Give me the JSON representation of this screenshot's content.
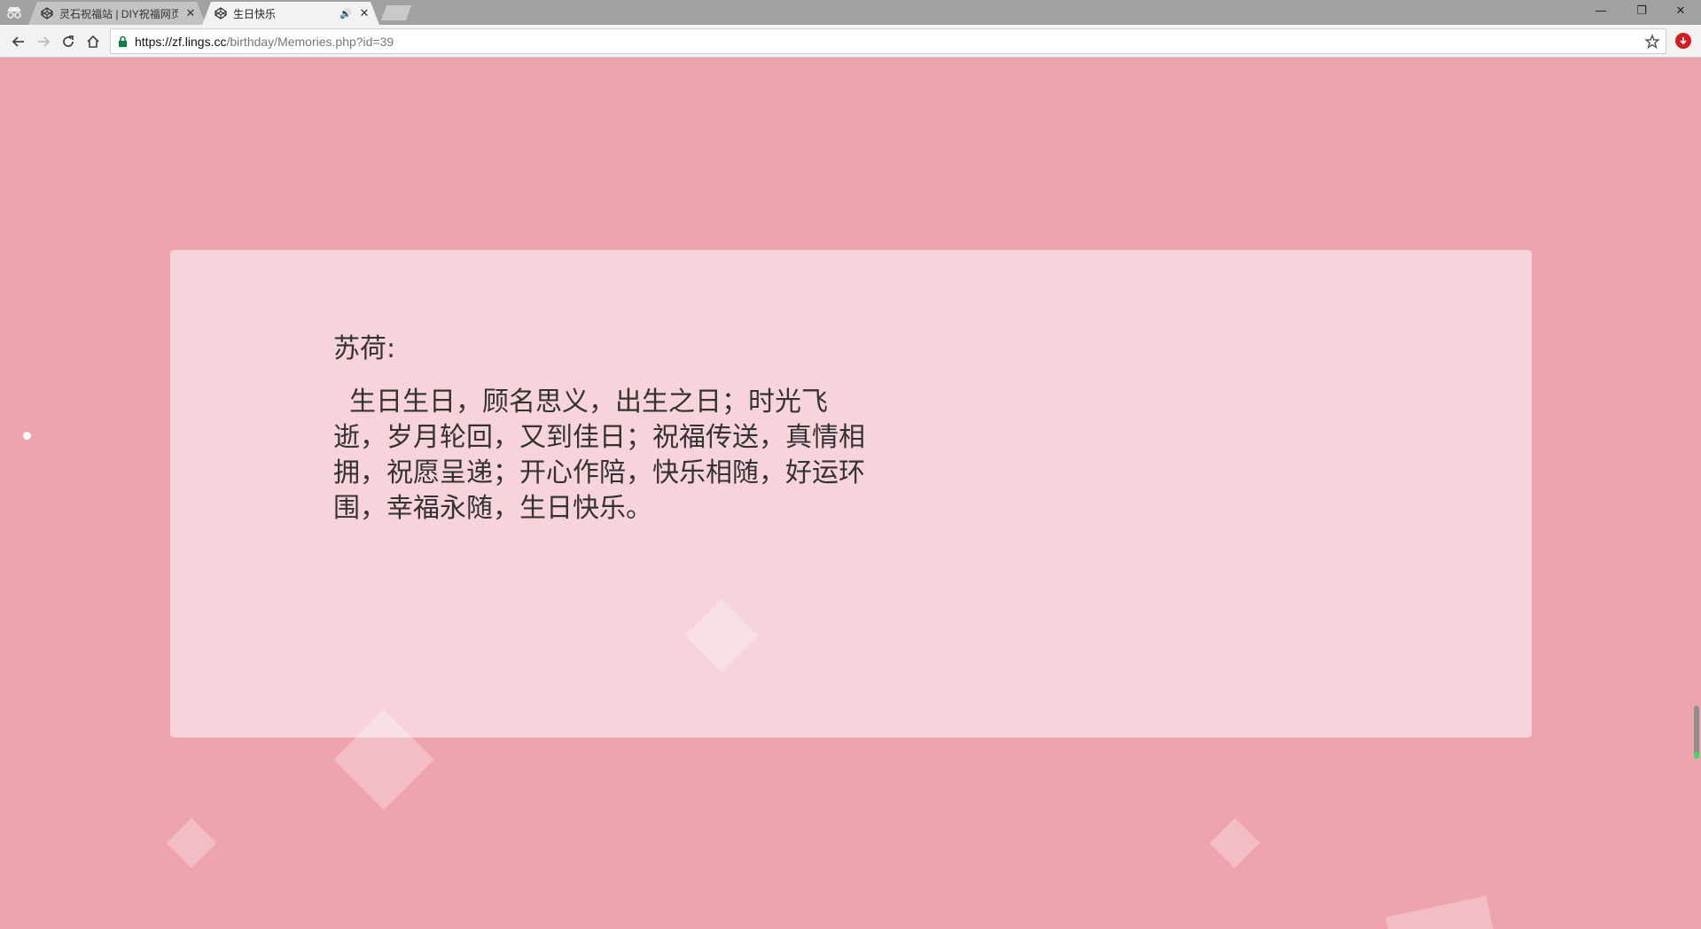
{
  "browser": {
    "tabs": [
      {
        "title": "灵石祝福站 | DIY祝福网页",
        "active": false
      },
      {
        "title": "生日快乐",
        "active": true,
        "audio": true
      }
    ],
    "url": {
      "host": "https://zf.lings.cc",
      "path": "/birthday/Memories.php?id=39"
    },
    "icons": {
      "incognito": "incognito-icon",
      "back": "back-arrow-icon",
      "forward": "forward-arrow-icon",
      "reload": "reload-icon",
      "home": "home-icon",
      "lock": "lock-icon",
      "bookmark": "star-icon",
      "extension": "extension-icon"
    }
  },
  "content": {
    "greeting": "苏荷:",
    "message": "生日生日，顾名思义，出生之日；时光飞逝，岁月轮回，又到佳日；祝福传送，真情相拥，祝愿呈递；开心作陪，快乐相随，好运环围，幸福永随，生日快乐。"
  },
  "colors": {
    "page_background": "#eea4ad",
    "card_background": "#f7d4da",
    "text": "#333333"
  }
}
